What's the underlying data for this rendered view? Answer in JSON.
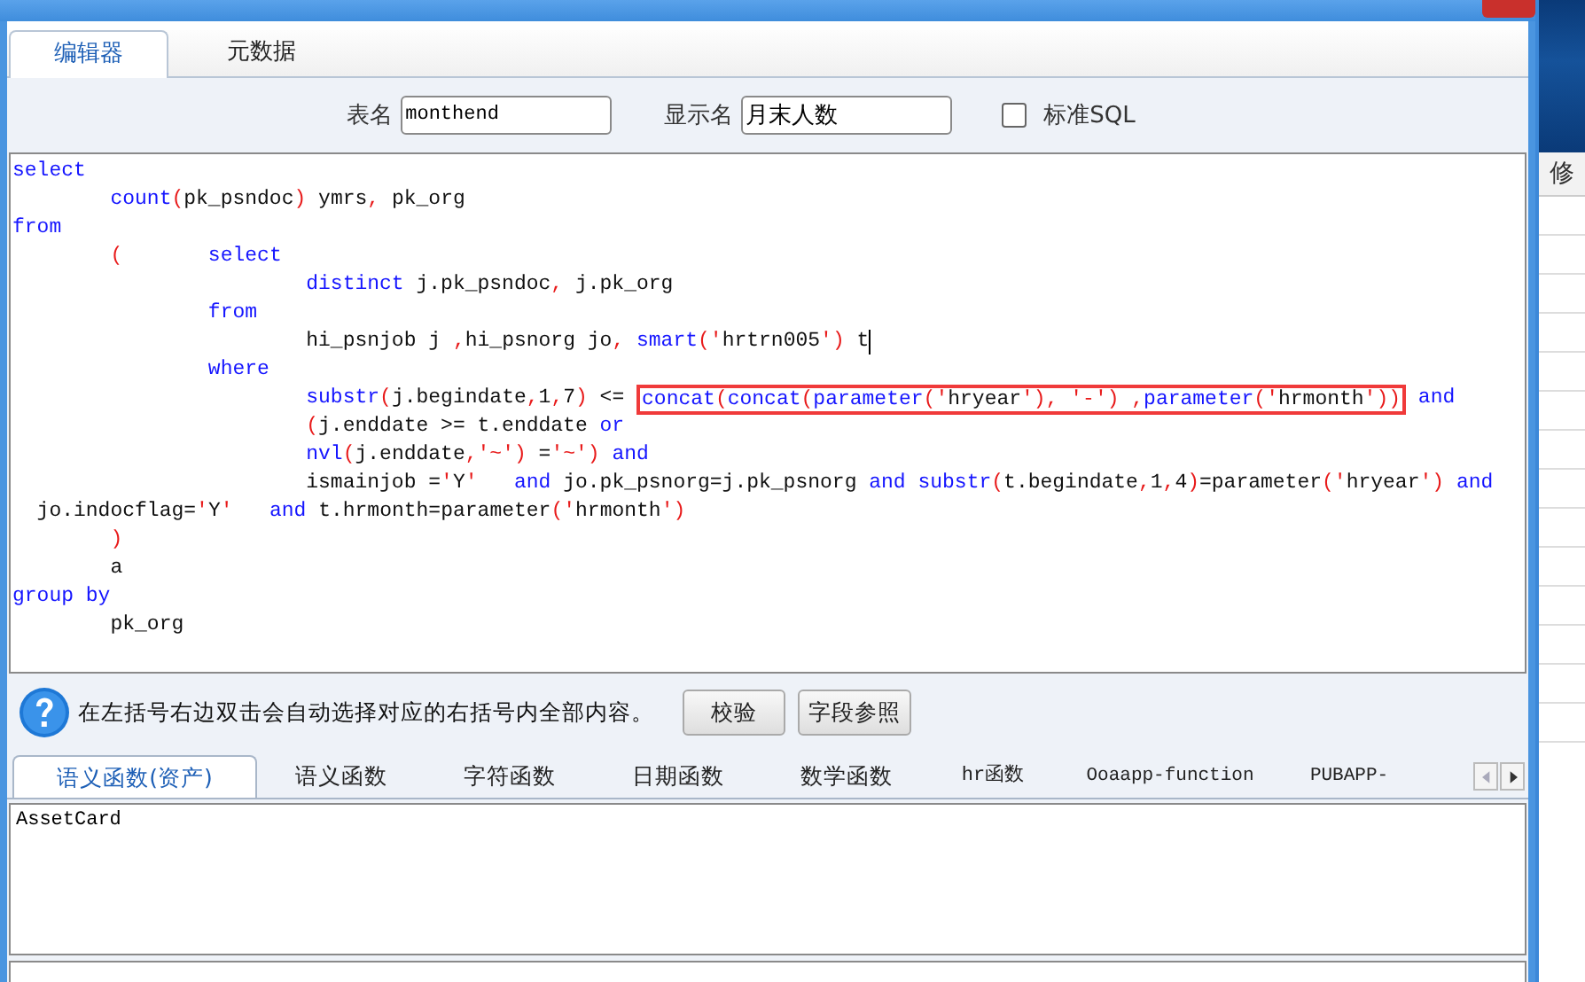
{
  "tabs": [
    {
      "label": "编辑器",
      "selected": true
    },
    {
      "label": "元数据",
      "selected": false
    }
  ],
  "form": {
    "table_name": {
      "label": "表名",
      "value": "monthend"
    },
    "display_name": {
      "label": "显示名",
      "value": "月末人数"
    },
    "standard_sql": {
      "label": "标准SQL",
      "checked": false
    }
  },
  "editor": {
    "lines": [
      {
        "segments": [
          {
            "kind": "kw",
            "text": "select"
          }
        ]
      },
      {
        "segments": [
          {
            "kind": "kw",
            "text": "        count"
          },
          {
            "kind": "punct",
            "text": "("
          },
          {
            "kind": "plain",
            "text": "pk_psndoc"
          },
          {
            "kind": "punct",
            "text": ")"
          },
          {
            "kind": "plain",
            "text": " ymrs"
          },
          {
            "kind": "punct",
            "text": ","
          },
          {
            "kind": "plain",
            "text": " pk_org"
          }
        ]
      },
      {
        "segments": [
          {
            "kind": "kw",
            "text": "from"
          }
        ]
      },
      {
        "segments": [
          {
            "kind": "punct",
            "text": "        ("
          },
          {
            "kind": "kw",
            "text": "       select"
          }
        ]
      },
      {
        "segments": [
          {
            "kind": "kw",
            "text": "                        distinct"
          },
          {
            "kind": "plain",
            "text": " j.pk_psndoc"
          },
          {
            "kind": "punct",
            "text": ","
          },
          {
            "kind": "plain",
            "text": " j.pk_org"
          }
        ]
      },
      {
        "segments": [
          {
            "kind": "kw",
            "text": "                from"
          }
        ]
      },
      {
        "segments": [
          {
            "kind": "plain",
            "text": "                        hi_psnjob j "
          },
          {
            "kind": "punct",
            "text": ","
          },
          {
            "kind": "plain",
            "text": "hi_psnorg jo"
          },
          {
            "kind": "punct",
            "text": ", "
          },
          {
            "kind": "kw",
            "text": "smart"
          },
          {
            "kind": "punct",
            "text": "('"
          },
          {
            "kind": "plain",
            "text": "hrtrn005"
          },
          {
            "kind": "punct",
            "text": "')"
          },
          {
            "kind": "plain",
            "text": " t"
          }
        ],
        "cursor": true
      },
      {
        "segments": [
          {
            "kind": "kw",
            "text": "                where"
          }
        ]
      },
      {
        "segments": [
          {
            "kind": "kw",
            "text": "                        substr"
          },
          {
            "kind": "punct",
            "text": "("
          },
          {
            "kind": "plain",
            "text": "j.begindate"
          },
          {
            "kind": "punct",
            "text": ","
          },
          {
            "kind": "plain",
            "text": "1"
          },
          {
            "kind": "punct",
            "text": ","
          },
          {
            "kind": "plain",
            "text": "7"
          },
          {
            "kind": "punct",
            "text": ")"
          },
          {
            "kind": "plain",
            "text": " <= "
          },
          {
            "kind": "boxed",
            "segments": [
              {
                "kind": "kw",
                "text": "concat"
              },
              {
                "kind": "punct",
                "text": "("
              },
              {
                "kind": "kw",
                "text": "concat"
              },
              {
                "kind": "punct",
                "text": "("
              },
              {
                "kind": "kw",
                "text": "parameter"
              },
              {
                "kind": "punct",
                "text": "('"
              },
              {
                "kind": "plain",
                "text": "hryear"
              },
              {
                "kind": "punct",
                "text": "'), '-') ,"
              },
              {
                "kind": "kw",
                "text": "parameter"
              },
              {
                "kind": "punct",
                "text": "('"
              },
              {
                "kind": "plain",
                "text": "hrmonth"
              },
              {
                "kind": "punct",
                "text": "'))"
              }
            ]
          },
          {
            "kind": "kw",
            "text": " and"
          }
        ]
      },
      {
        "segments": [
          {
            "kind": "punct",
            "text": "                        ("
          },
          {
            "kind": "plain",
            "text": "j.enddate >= t.enddate "
          },
          {
            "kind": "kw",
            "text": "or"
          }
        ]
      },
      {
        "segments": [
          {
            "kind": "kw",
            "text": "                        nvl"
          },
          {
            "kind": "punct",
            "text": "("
          },
          {
            "kind": "plain",
            "text": "j.enddate"
          },
          {
            "kind": "punct",
            "text": ",'~')"
          },
          {
            "kind": "plain",
            "text": " ="
          },
          {
            "kind": "punct",
            "text": "'~')"
          },
          {
            "kind": "kw",
            "text": " and"
          }
        ]
      },
      {
        "segments": [
          {
            "kind": "plain",
            "text": "                        ismainjob ="
          },
          {
            "kind": "punct",
            "text": "'"
          },
          {
            "kind": "plain",
            "text": "Y"
          },
          {
            "kind": "punct",
            "text": "'"
          },
          {
            "kind": "kw",
            "text": "   and"
          },
          {
            "kind": "plain",
            "text": " jo.pk_psnorg=j.pk_psnorg "
          },
          {
            "kind": "kw",
            "text": "and substr"
          },
          {
            "kind": "punct",
            "text": "("
          },
          {
            "kind": "plain",
            "text": "t.begindate"
          },
          {
            "kind": "punct",
            "text": ","
          },
          {
            "kind": "plain",
            "text": "1"
          },
          {
            "kind": "punct",
            "text": ","
          },
          {
            "kind": "plain",
            "text": "4"
          },
          {
            "kind": "punct",
            "text": ")"
          },
          {
            "kind": "plain",
            "text": "=parameter"
          },
          {
            "kind": "punct",
            "text": "('"
          },
          {
            "kind": "plain",
            "text": "hryear"
          },
          {
            "kind": "punct",
            "text": "')"
          },
          {
            "kind": "kw",
            "text": " and"
          }
        ]
      },
      {
        "segments": [
          {
            "kind": "plain",
            "text": "  jo.indocflag="
          },
          {
            "kind": "punct",
            "text": "'"
          },
          {
            "kind": "plain",
            "text": "Y"
          },
          {
            "kind": "punct",
            "text": "'"
          },
          {
            "kind": "kw",
            "text": "   and"
          },
          {
            "kind": "plain",
            "text": " t.hrmonth=parameter"
          },
          {
            "kind": "punct",
            "text": "('"
          },
          {
            "kind": "plain",
            "text": "hrmonth"
          },
          {
            "kind": "punct",
            "text": "')"
          }
        ]
      },
      {
        "segments": [
          {
            "kind": "punct",
            "text": "        )"
          }
        ]
      },
      {
        "segments": [
          {
            "kind": "plain",
            "text": "        a"
          }
        ]
      },
      {
        "segments": [
          {
            "kind": "kw",
            "text": "group by"
          }
        ]
      },
      {
        "segments": [
          {
            "kind": "plain",
            "text": "        pk_org"
          }
        ]
      }
    ]
  },
  "hint": "在左括号右边双击会自动选择对应的右括号内全部内容。",
  "buttons": [
    "校验",
    "字段参照"
  ],
  "function_tabs": [
    {
      "label": "语义函数(资产)",
      "selected": true
    },
    {
      "label": "语义函数",
      "selected": false
    },
    {
      "label": "字符函数",
      "selected": false
    },
    {
      "label": "日期函数",
      "selected": false
    },
    {
      "label": "数学函数",
      "selected": false
    },
    {
      "label": "hr函数",
      "selected": false
    },
    {
      "label": "Ooaapp-function",
      "selected": false
    },
    {
      "label": "PUBAPP-",
      "selected": false
    }
  ],
  "function_list": [
    "AssetCard"
  ],
  "background_window": {
    "column_header": "修"
  }
}
